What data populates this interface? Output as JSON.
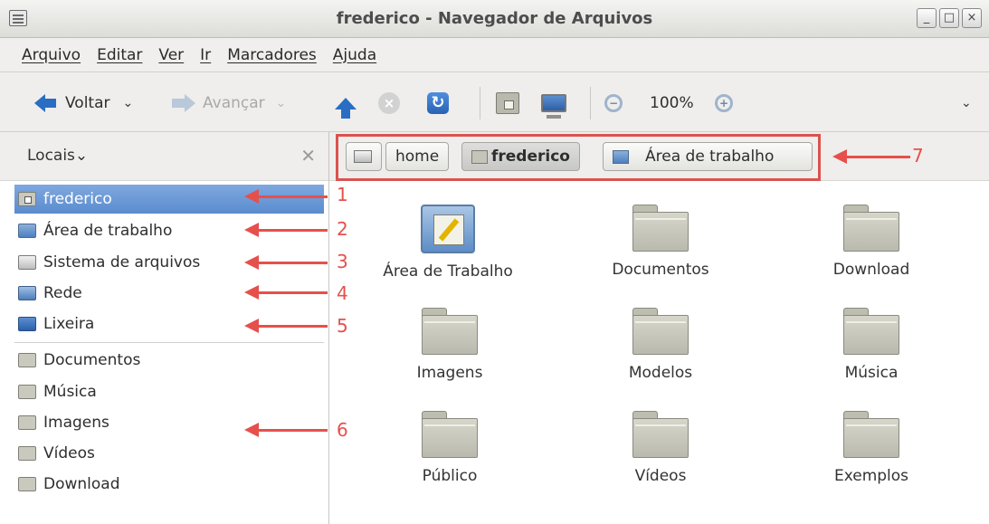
{
  "window": {
    "title": "frederico - Navegador de Arquivos",
    "controls": [
      "_",
      "□",
      "×"
    ]
  },
  "menu": [
    "Arquivo",
    "Editar",
    "Ver",
    "Ir",
    "Marcadores",
    "Ajuda"
  ],
  "toolbar": {
    "back_label": "Voltar",
    "forward_label": "Avançar",
    "zoom_level": "100%",
    "back_chevron": "⌄",
    "overflow_chevron": "⌄"
  },
  "sidebar": {
    "header_label": "Locais",
    "header_chevron": "⌄",
    "close_glyph": "✕",
    "places": [
      {
        "label": "frederico",
        "icon": "home-folder-icon",
        "selected": true
      },
      {
        "label": "Área de trabalho",
        "icon": "desktop-icon"
      },
      {
        "label": "Sistema de arquivos",
        "icon": "drive-icon"
      },
      {
        "label": "Rede",
        "icon": "network-icon"
      },
      {
        "label": "Lixeira",
        "icon": "trash-icon"
      }
    ],
    "bookmarks": [
      {
        "label": "Documentos",
        "icon": "folder-icon"
      },
      {
        "label": "Música",
        "icon": "folder-icon"
      },
      {
        "label": "Imagens",
        "icon": "folder-icon"
      },
      {
        "label": "Vídeos",
        "icon": "folder-icon"
      },
      {
        "label": "Download",
        "icon": "folder-icon"
      }
    ]
  },
  "pathbar": {
    "buttons": [
      "home",
      "frederico",
      "Área de trabalho"
    ]
  },
  "files": [
    {
      "label": "Área de Trabalho",
      "icon": "desktop-icon"
    },
    {
      "label": "Documentos",
      "icon": "folder-icon"
    },
    {
      "label": "Download",
      "icon": "folder-icon"
    },
    {
      "label": "Imagens",
      "icon": "folder-icon"
    },
    {
      "label": "Modelos",
      "icon": "folder-icon"
    },
    {
      "label": "Música",
      "icon": "folder-icon"
    },
    {
      "label": "Público",
      "icon": "folder-icon"
    },
    {
      "label": "Vídeos",
      "icon": "folder-icon"
    },
    {
      "label": "Exemplos",
      "icon": "folder-icon"
    }
  ],
  "annotations": {
    "numbers": [
      "1",
      "2",
      "3",
      "4",
      "5",
      "6",
      "7"
    ],
    "color": "#e6504c"
  }
}
